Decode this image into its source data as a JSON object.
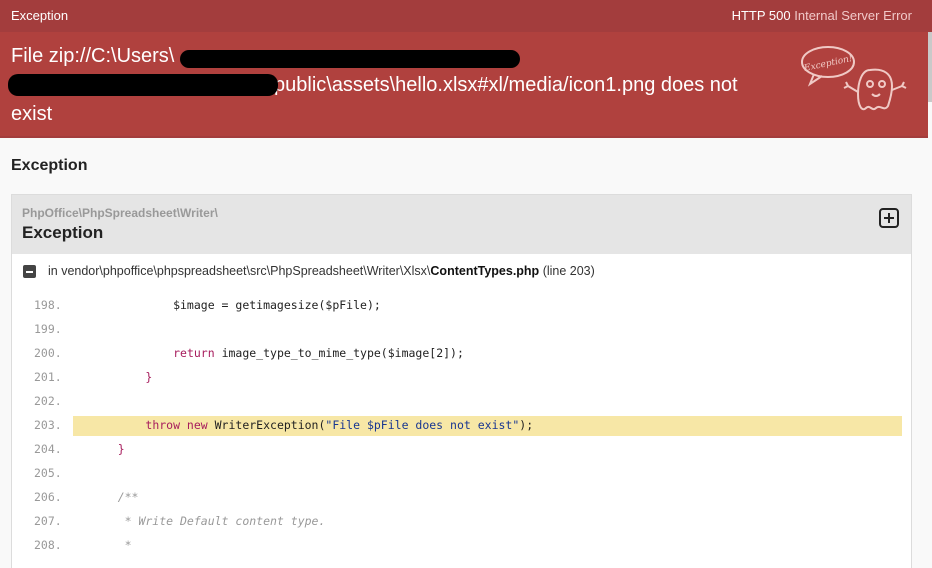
{
  "topbar": {
    "left": "Exception",
    "status_code": "HTTP 500",
    "status_text": "Internal Server Error"
  },
  "hero": {
    "line1": "File zip://C:\\Users\\",
    "line2_visible": "public\\assets\\hello.xlsx#xl/media/icon1.png does not",
    "line3": "exist",
    "mascot_text": "Exception!"
  },
  "section_title": "Exception",
  "card": {
    "namespace": "PhpOffice\\PhpSpreadsheet\\Writer\\",
    "class": "Exception",
    "file_prefix": "in vendor\\phpoffice\\phpspreadsheet\\src\\PhpSpreadsheet\\Writer\\Xlsx\\",
    "file_name": "ContentTypes.php",
    "file_line": "(line 203)"
  },
  "code": {
    "highlight_line": "203.",
    "lines": [
      {
        "num": "198.",
        "text": "            $image = getimagesize($pFile);"
      },
      {
        "num": "199.",
        "text": ""
      },
      {
        "num": "200.",
        "text": "            return image_type_to_mime_type($image[2]);"
      },
      {
        "num": "201.",
        "text": "        }"
      },
      {
        "num": "202.",
        "text": ""
      },
      {
        "num": "203.",
        "text": "        throw new WriterException(\"File $pFile does not exist\");"
      },
      {
        "num": "204.",
        "text": "    }"
      },
      {
        "num": "205.",
        "text": ""
      },
      {
        "num": "206.",
        "text": "    /**"
      },
      {
        "num": "207.",
        "text": "     * Write Default content type."
      },
      {
        "num": "208.",
        "text": "     *"
      }
    ]
  },
  "colors": {
    "topbar": "#a33d3d",
    "hero": "#b0413e",
    "highlight": "#f7e7a6"
  }
}
